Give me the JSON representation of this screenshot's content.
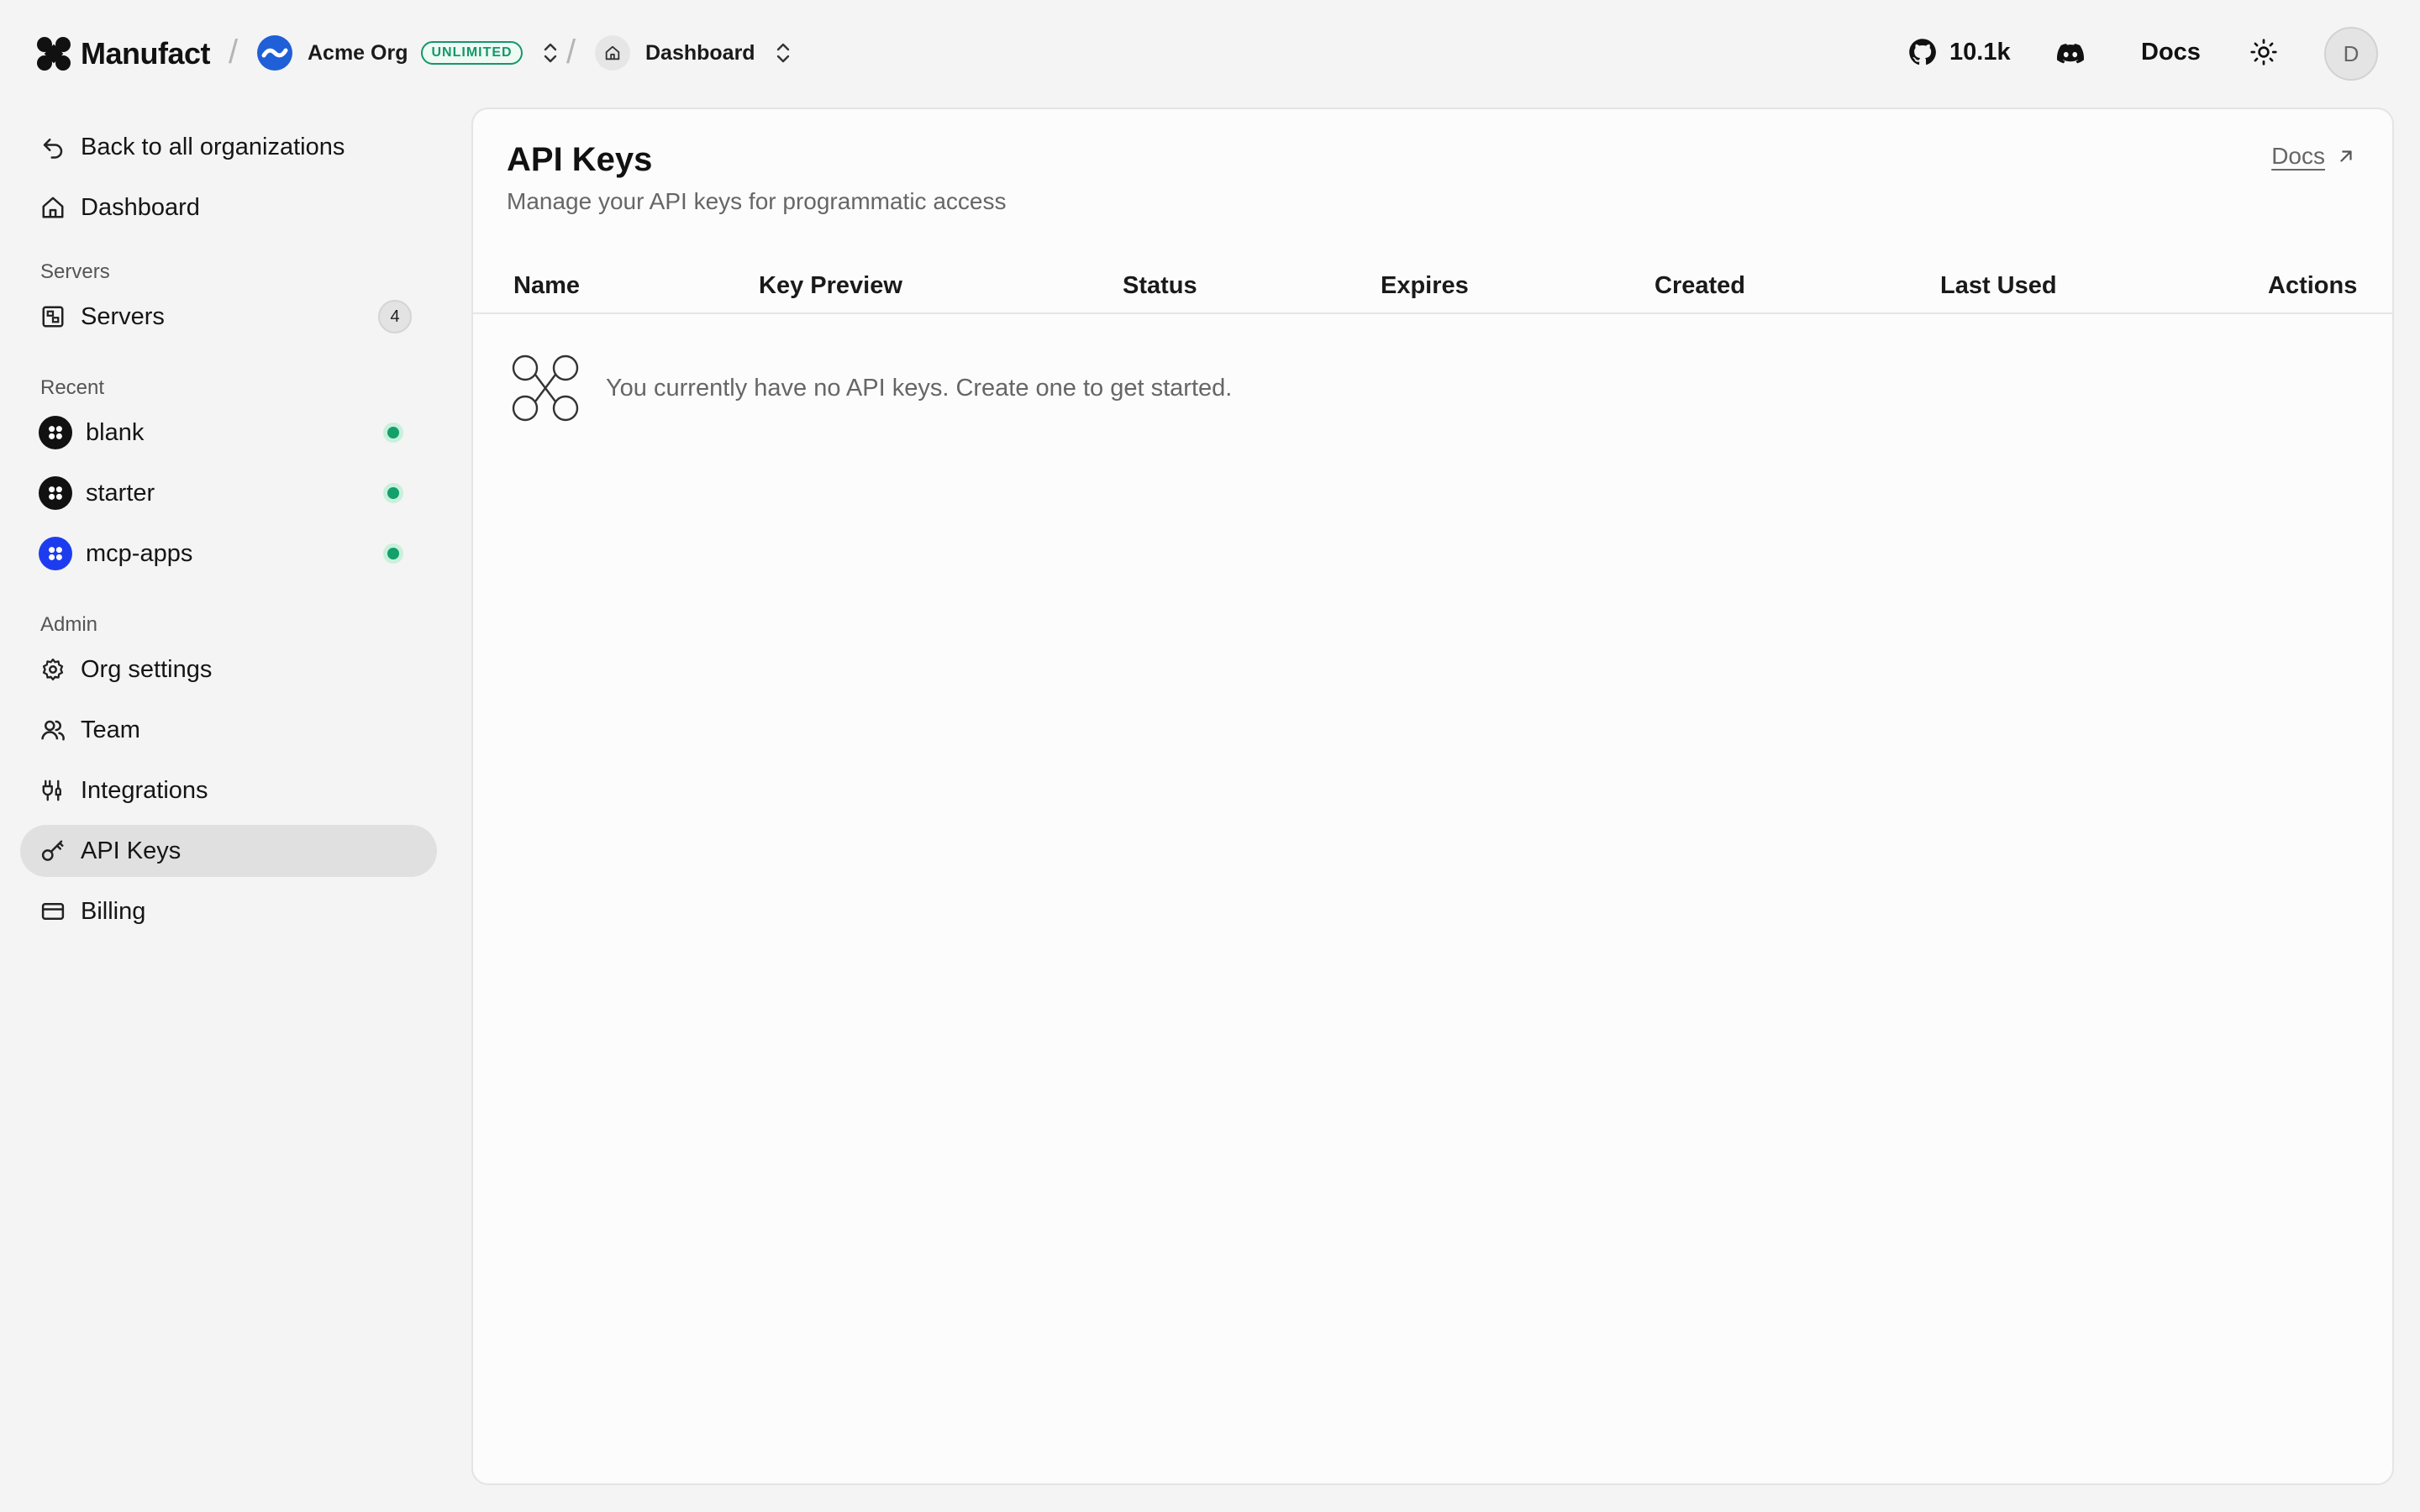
{
  "header": {
    "brand": "Manufact",
    "separator": "/",
    "org_name": "Acme Org",
    "plan_badge": "UNLIMITED",
    "crumb_label": "Dashboard",
    "github_stars": "10.1k",
    "docs_label": "Docs",
    "user_initial": "D"
  },
  "sidebar": {
    "back_label": "Back to all organizations",
    "dashboard_label": "Dashboard",
    "servers_section": "Servers",
    "servers_label": "Servers",
    "servers_count": "4",
    "recent_section": "Recent",
    "recent": [
      {
        "label": "blank",
        "icon": "project-icon"
      },
      {
        "label": "starter",
        "icon": "project-icon"
      },
      {
        "label": "mcp-apps",
        "icon": "project-icon"
      }
    ],
    "admin_section": "Admin",
    "admin": [
      {
        "label": "Org settings",
        "icon": "gear-icon"
      },
      {
        "label": "Team",
        "icon": "users-icon"
      },
      {
        "label": "Integrations",
        "icon": "plug-icon"
      },
      {
        "label": "API Keys",
        "icon": "key-icon"
      },
      {
        "label": "Billing",
        "icon": "credit-card-icon"
      }
    ]
  },
  "main": {
    "title": "API Keys",
    "subtitle": "Manage your API keys for programmatic access",
    "docs_link": "Docs",
    "columns": [
      "Name",
      "Key Preview",
      "Status",
      "Expires",
      "Created",
      "Last Used",
      "Actions"
    ],
    "empty_message": "You currently have no API keys. Create one to get started."
  },
  "colors": {
    "background": "#f4f4f4",
    "panel": "#fcfcfc",
    "active_nav": "#e0e0e0",
    "status_green": "#13a06a",
    "org_blue": "#1f5fd8",
    "project_blue": "#1d3cf0"
  }
}
